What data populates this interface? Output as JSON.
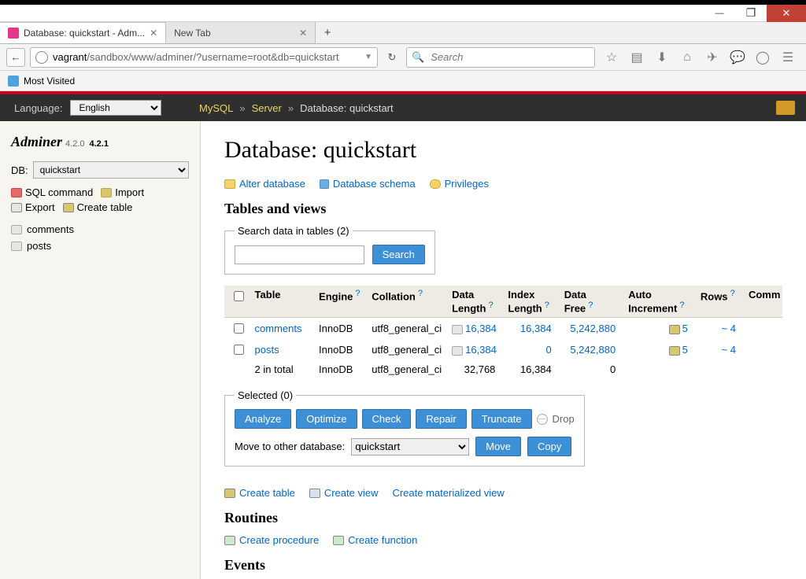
{
  "browser": {
    "tabs": [
      {
        "title": "Database: quickstart - Adm...",
        "active": true
      },
      {
        "title": "New Tab",
        "active": false
      }
    ],
    "url_prefix": "vagrant",
    "url_rest": "/sandbox/www/adminer/?username=root&db=quickstart",
    "search_placeholder": "Search",
    "bookmark": "Most Visited"
  },
  "app": {
    "language_label": "Language:",
    "language_value": "English",
    "crumb_mysql": "MySQL",
    "crumb_server": "Server",
    "crumb_db": "Database: quickstart",
    "brand": "Adminer",
    "version1": "4.2.0",
    "version2": "4.2.1"
  },
  "sidebar": {
    "db_label": "DB:",
    "db_value": "quickstart",
    "links": {
      "sql": "SQL command",
      "import": "Import",
      "export": "Export",
      "create": "Create table"
    },
    "tables": [
      "comments",
      "posts"
    ]
  },
  "content": {
    "title": "Database: quickstart",
    "links": {
      "alter": "Alter database",
      "schema": "Database schema",
      "privileges": "Privileges"
    },
    "tables_heading": "Tables and views",
    "search_legend": "Search data in tables (2)",
    "search_btn": "Search",
    "columns": {
      "table": "Table",
      "engine": "Engine",
      "collation": "Collation",
      "data_length": "Data Length",
      "index_length": "Index Length",
      "data_free": "Data Free",
      "auto_increment": "Auto Increment",
      "rows": "Rows",
      "comment": "Comment"
    },
    "rows": [
      {
        "name": "comments",
        "engine": "InnoDB",
        "collation": "utf8_general_ci",
        "data_length": "16,384",
        "index_length": "16,384",
        "data_free": "5,242,880",
        "auto_increment": "5",
        "rows": "~ 4"
      },
      {
        "name": "posts",
        "engine": "InnoDB",
        "collation": "utf8_general_ci",
        "data_length": "16,384",
        "index_length": "0",
        "data_free": "5,242,880",
        "auto_increment": "5",
        "rows": "~ 4"
      }
    ],
    "footer": {
      "label": "2 in total",
      "engine": "InnoDB",
      "collation": "utf8_general_ci",
      "data_length": "32,768",
      "index_length": "16,384",
      "data_free": "0"
    },
    "selected_legend": "Selected (0)",
    "buttons": {
      "analyze": "Analyze",
      "optimize": "Optimize",
      "check": "Check",
      "repair": "Repair",
      "truncate": "Truncate",
      "drop": "Drop"
    },
    "move_label": "Move to other database:",
    "move_value": "quickstart",
    "move_btn": "Move",
    "copy_btn": "Copy",
    "create_links": {
      "table": "Create table",
      "view": "Create view",
      "matview": "Create materialized view"
    },
    "routines_heading": "Routines",
    "routines_links": {
      "proc": "Create procedure",
      "func": "Create function"
    },
    "events_heading": "Events"
  }
}
